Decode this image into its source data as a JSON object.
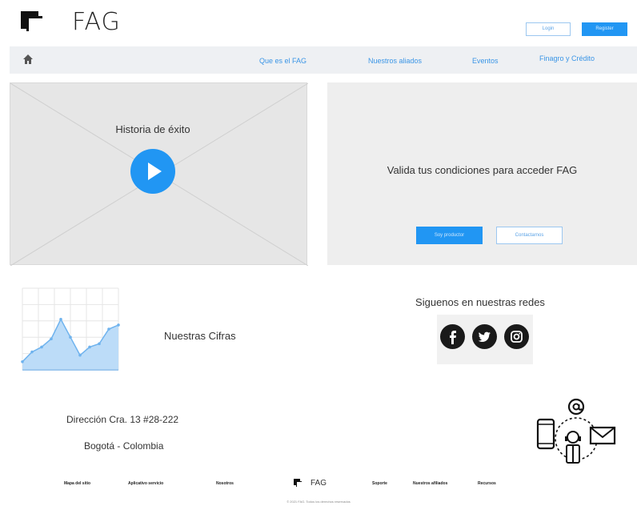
{
  "header": {
    "logo_text": "FAG",
    "login_label": "Login",
    "register_label": "Register"
  },
  "nav": {
    "items": [
      {
        "label": "Que es el FAG"
      },
      {
        "label": "Nuestros aliados"
      },
      {
        "label": "Eventos"
      },
      {
        "label": "Finagro y Crédito"
      }
    ]
  },
  "video": {
    "title": "Historia de éxito"
  },
  "conditions": {
    "text": "Valida tus condiciones para acceder FAG",
    "primary_label": "Soy productor",
    "secondary_label": "Contactarnos"
  },
  "stats": {
    "label": "Nuestras Cifras"
  },
  "chart_data": {
    "type": "area",
    "x": [
      0,
      1,
      2,
      3,
      4,
      5,
      6,
      7,
      8,
      9,
      10
    ],
    "values": [
      10,
      22,
      28,
      38,
      62,
      40,
      18,
      28,
      32,
      50,
      55
    ],
    "xlabel": "",
    "ylabel": "",
    "ylim": [
      0,
      100
    ],
    "grid": true,
    "fill_color": "#bcdcf8",
    "line_color": "#6fb3ee"
  },
  "social": {
    "title": "Siguenos en nuestras redes",
    "icons": [
      "facebook-icon",
      "twitter-icon",
      "instagram-icon"
    ]
  },
  "address": {
    "line1": "Dirección Cra. 13 #28-222",
    "line2": "Bogotá - Colombia"
  },
  "footer": {
    "links": [
      {
        "label": "Mapa del sitio"
      },
      {
        "label": "Aplicativo servicio"
      },
      {
        "label": "Nosotros"
      },
      {
        "label": "Soporte"
      },
      {
        "label": "Nuestros afiliados"
      },
      {
        "label": "Recursos"
      }
    ],
    "logo_text": "FAG",
    "copyright": "© 2021 FAG. Todos los derechos reservados"
  },
  "colors": {
    "accent": "#2196f3",
    "panel_bg": "#eeeeee",
    "nav_bg": "#eef0f3"
  }
}
